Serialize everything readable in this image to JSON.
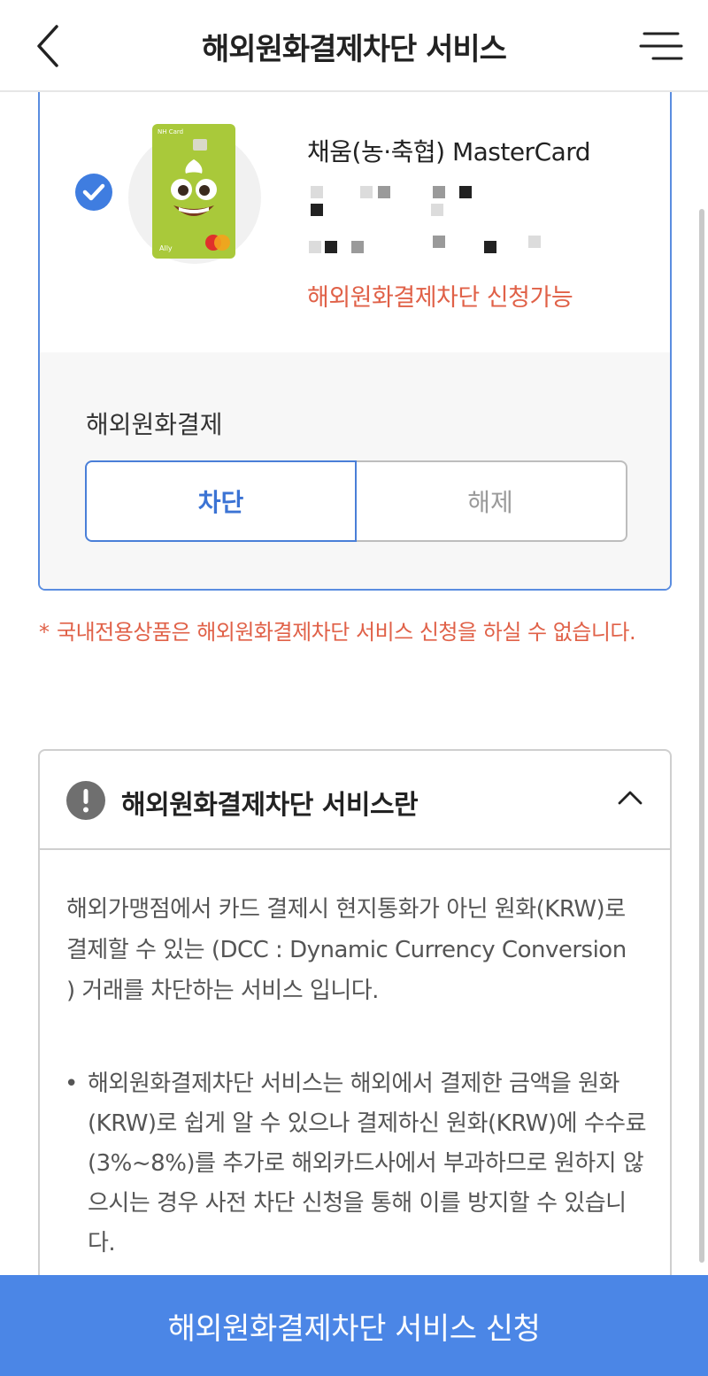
{
  "header": {
    "title": "해외원화결제차단 서비스"
  },
  "card": {
    "selected": true,
    "name": "채움(농·축협) MasterCard",
    "status": "해외원화결제차단 신청가능",
    "image_label": "NH Card",
    "image_sublabel": "Ally"
  },
  "options": {
    "label": "해외원화결제",
    "block_label": "차단",
    "release_label": "해제",
    "selected": "차단"
  },
  "notice": {
    "star": "*",
    "text": "국내전용상품은 해외원화결제차단 서비스 신청을 하실 수 없습니다."
  },
  "info": {
    "title": "해외원화결제차단 서비스란",
    "description": "해외가맹점에서 카드 결제시 현지통화가 아닌 원화(KRW)로 결제할 수 있는 (DCC : Dynamic Currency Conversion ) 거래를 차단하는 서비스 입니다.",
    "bullet": "해외원화결제차단 서비스는 해외에서 결제한 금액을 원화(KRW)로 쉽게 알 수 있으나 결제하신 원화(KRW)에 수수료(3%~8%)를 추가로 해외카드사에서 부과하므로 원하지 않으시는 경우 사전 차단 신청을 통해 이를 방지할 수 있습니다.",
    "bullet_mark": "•"
  },
  "cta": {
    "label": "해외원화결제차단 서비스 신청"
  },
  "colors": {
    "accent": "#4b86e6",
    "warning": "#e06148",
    "card_green": "#a9c93a"
  },
  "icons": {
    "back": "chevron-left-icon",
    "menu": "menu-icon",
    "check": "check-circle-icon",
    "info": "exclamation-circle-icon",
    "collapse": "chevron-up-icon"
  }
}
